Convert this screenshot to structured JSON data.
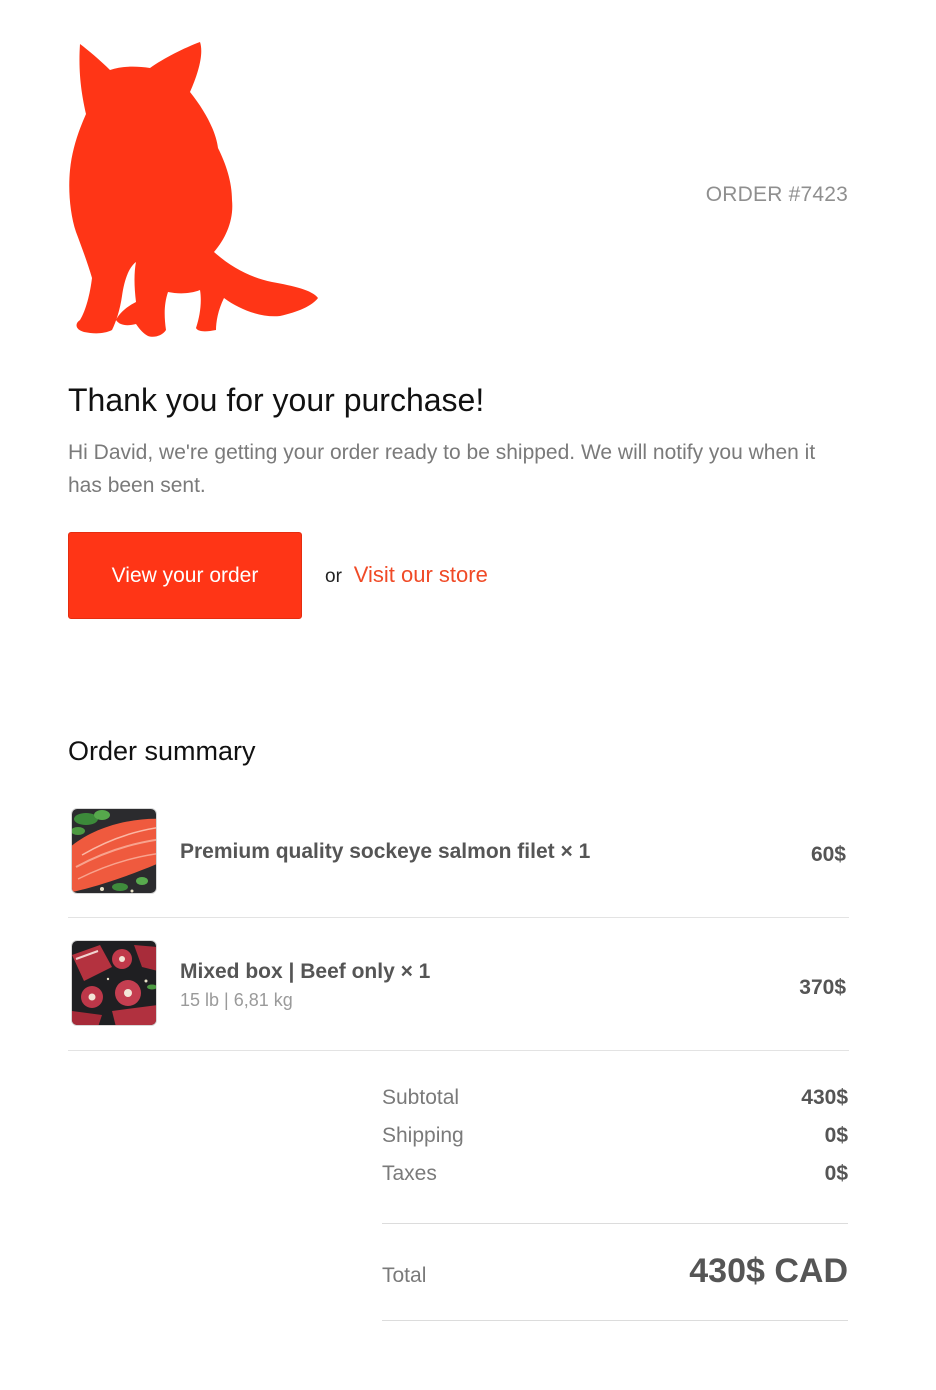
{
  "brand": {
    "logo_icon": "fox-silhouette-icon",
    "logo_color": "#ff3516"
  },
  "header": {
    "order_number": "ORDER #7423"
  },
  "message": {
    "title": "Thank you for your purchase!",
    "body": "Hi David, we're getting your order ready to be shipped. We will notify you when it has been sent."
  },
  "actions": {
    "view_order_label": "View your order",
    "or_text": "or",
    "store_link_label": "Visit our store",
    "accent_color": "#ff3516",
    "link_color": "#f04a26"
  },
  "summary": {
    "title": "Order summary",
    "items": [
      {
        "name": "Premium quality sockeye salmon filet × 1",
        "variant": "",
        "price": "60$",
        "image_icon": "salmon-filet-image"
      },
      {
        "name": "Mixed box | Beef only × 1",
        "variant": "15 lb | 6,81 kg",
        "price": "370$",
        "image_icon": "beef-cuts-image"
      }
    ],
    "subtotal_label": "Subtotal",
    "subtotal_value": "430$",
    "shipping_label": "Shipping",
    "shipping_value": "0$",
    "taxes_label": "Taxes",
    "taxes_value": "0$",
    "total_label": "Total",
    "total_value": "430$ CAD"
  }
}
